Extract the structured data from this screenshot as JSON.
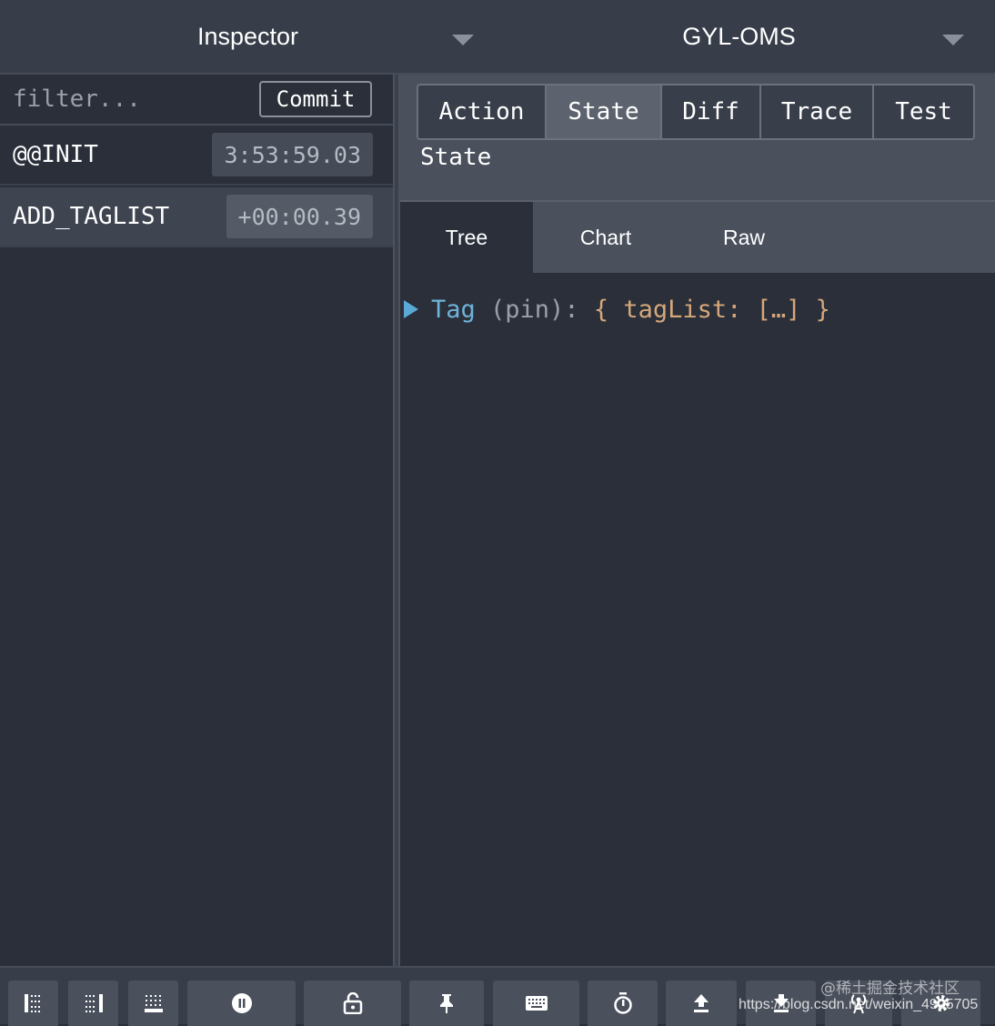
{
  "topbar": {
    "left_dropdown": "Inspector",
    "right_dropdown": "GYL-OMS"
  },
  "left_panel": {
    "filter_placeholder": "filter...",
    "commit_label": "Commit",
    "actions": [
      {
        "name": "@@INIT",
        "time": "3:53:59.03",
        "selected": false
      },
      {
        "name": "ADD_TAGLIST",
        "time": "+00:00.39",
        "selected": true
      }
    ]
  },
  "right_panel": {
    "tabs": [
      "Action",
      "State",
      "Diff",
      "Trace",
      "Test"
    ],
    "active_tab": "State",
    "section_title": "State",
    "subtabs": [
      "Tree",
      "Chart",
      "Raw"
    ],
    "active_subtab": "Tree",
    "tree": {
      "key": "Tag",
      "meta": " (pin): ",
      "value": "{ tagList: […] }"
    }
  },
  "footer": {
    "buttons": [
      "dock-left-icon",
      "dock-right-icon",
      "dock-bottom-icon",
      "pause-icon",
      "lock-icon",
      "pin-icon",
      "keyboard-icon",
      "timer-icon",
      "upload-icon",
      "download-icon",
      "remote-icon",
      "settings-icon"
    ]
  },
  "watermark": {
    "line1": "@稀土掘金技术社区",
    "line2": "https://blog.csdn.net/weixin_4925705"
  },
  "colors": {
    "background": "#2a2f3a",
    "header": "#373d49",
    "tree_key": "#6fb3d9",
    "tree_value": "#d6a77a"
  }
}
